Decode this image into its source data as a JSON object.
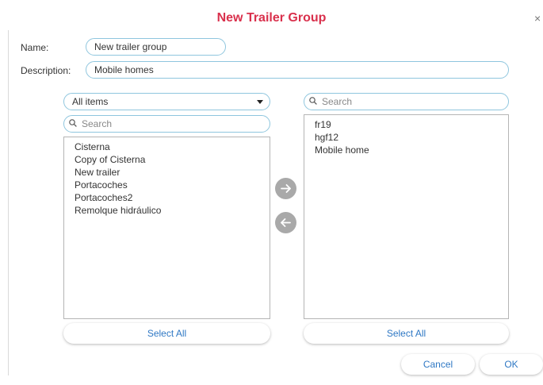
{
  "dialog": {
    "title": "New Trailer Group",
    "close_glyph": "×"
  },
  "form": {
    "name_label": "Name:",
    "name_value": "New trailer group",
    "description_label": "Description:",
    "description_value": "Mobile homes"
  },
  "left_panel": {
    "filter_value": "All items",
    "search_placeholder": "Search",
    "items": [
      "Cisterna",
      "Copy of Cisterna",
      "New trailer",
      "Portacoches",
      "Portacoches2",
      "Remolque hidráulico"
    ],
    "select_all_label": "Select All"
  },
  "right_panel": {
    "search_placeholder": "Search",
    "items": [
      "fr19",
      "hgf12",
      "Mobile home"
    ],
    "select_all_label": "Select All"
  },
  "footer": {
    "cancel_label": "Cancel",
    "ok_label": "OK"
  },
  "colors": {
    "title": "#d9304c",
    "field_border": "#8fc6de",
    "link_text": "#2f78c4",
    "arrow_button": "#a9a9a9"
  },
  "icons": {
    "add": "arrow-right-icon",
    "remove": "arrow-left-icon",
    "search": "search-icon",
    "close": "close-icon",
    "dropdown": "chevron-down-icon"
  }
}
